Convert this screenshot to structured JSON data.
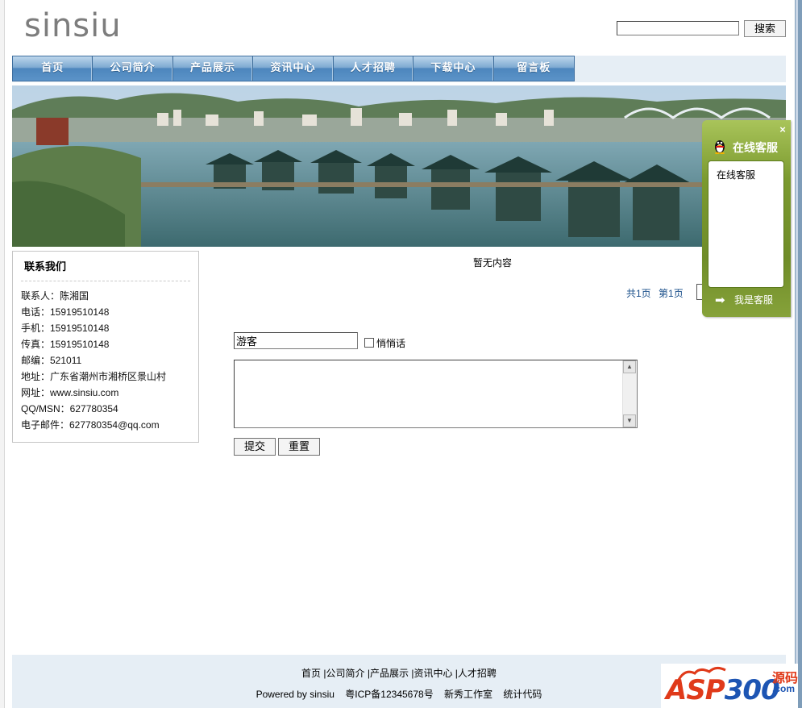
{
  "header": {
    "logo_text": "sinsiu",
    "search_placeholder": "",
    "search_button": "搜索"
  },
  "nav": {
    "items": [
      "首页",
      "公司简介",
      "产品展示",
      "资讯中心",
      "人才招聘",
      "下载中心",
      "留言板"
    ]
  },
  "contact": {
    "title": "联系我们",
    "lines": [
      "联系人：陈湘国",
      "电话：15919510148",
      "手机：15919510148",
      "传真：15919510148",
      "邮编：521011",
      "地址：广东省潮州市湘桥区景山村",
      "网址：www.sinsiu.com",
      "QQ/MSN：627780354",
      "电子邮件：627780354@qq.com"
    ]
  },
  "guestbook": {
    "empty_text": "暂无内容",
    "pager_total": "共1页",
    "pager_current": "第1页",
    "name_value": "游客",
    "quiet_label": "悄悄话",
    "message_value": "",
    "submit_label": "提交",
    "reset_label": "重置"
  },
  "customer_service": {
    "close": "×",
    "title": "在线客服",
    "item": "在线客服",
    "footer": "我是客服"
  },
  "footer": {
    "links": [
      "首页",
      "公司简介",
      "产品展示",
      "资讯中心",
      "人才招聘"
    ],
    "powered": "Powered by sinsiu",
    "icp": "粤ICP备12345678号",
    "studio": "新秀工作室",
    "stats": "统计代码"
  },
  "watermark": {
    "brand_a": "ASP",
    "brand_b": "300",
    "side": "源码",
    "com": ".com"
  },
  "colors": {
    "nav_blue": "#4d86bd",
    "strip_bg": "#e6eef5",
    "cs_green": "#7b9a2f",
    "pager_link": "#1a4f8a"
  },
  "icons": [
    "qq-penguin-icon",
    "close-icon",
    "arrow-right-icon",
    "scroll-up-icon",
    "scroll-down-icon"
  ]
}
